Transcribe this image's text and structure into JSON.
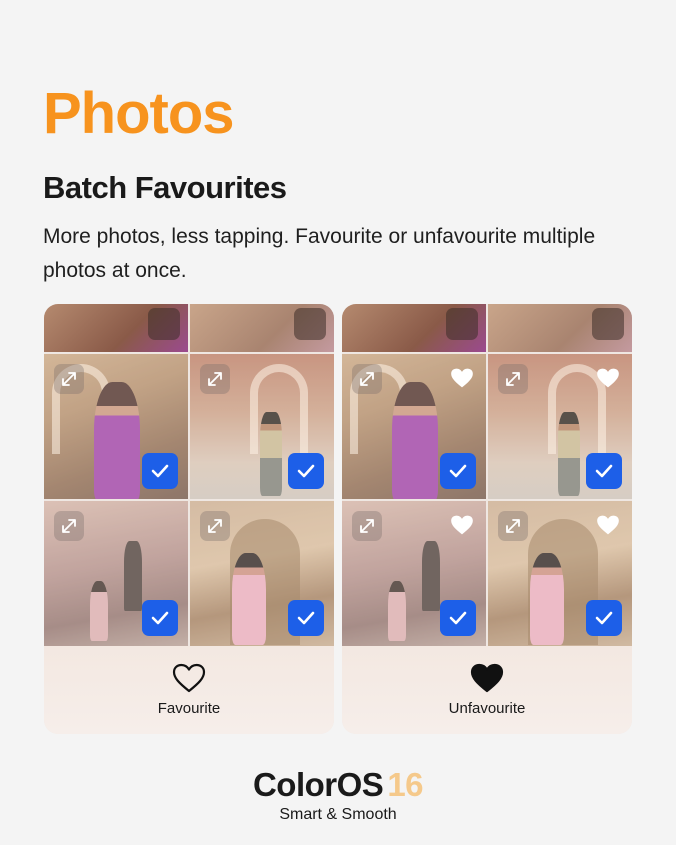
{
  "header": {
    "app_title": "Photos",
    "feature_title": "Batch Favourites",
    "description": "More photos, less tapping. Favourite or unfavourite multiple photos at once."
  },
  "colors": {
    "accent": "#f7931e",
    "check_blue": "#1d5fe8",
    "version_color": "#f5c98b"
  },
  "panels": [
    {
      "id": "left",
      "action_label": "Favourite",
      "action_icon": "heart-outline-icon",
      "photos_favourited": false,
      "photos_selected": 4
    },
    {
      "id": "right",
      "action_label": "Unfavourite",
      "action_icon": "heart-filled-icon",
      "photos_favourited": true,
      "photos_selected": 4
    }
  ],
  "brand": {
    "name": "ColorOS",
    "version": "16",
    "tagline": "Smart & Smooth"
  }
}
